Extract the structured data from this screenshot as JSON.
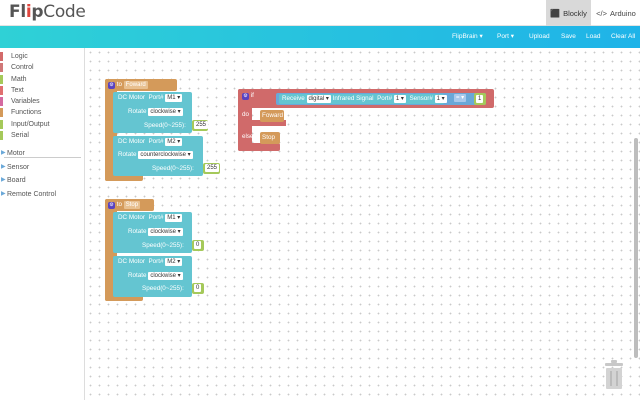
{
  "app": {
    "logo_left": "Fl",
    "logo_dot": "i",
    "logo_mid": "p",
    "logo_right": "Code"
  },
  "tabs": [
    {
      "label": "Blockly",
      "icon": "puzzle-icon"
    },
    {
      "label": "Arduino",
      "icon": "code-icon"
    }
  ],
  "toolbar": {
    "flipbrain": "FlipBrain",
    "port": "Port",
    "upload": "Upload",
    "save": "Save",
    "load": "Load",
    "clear": "Clear All"
  },
  "toolbox": {
    "categories": [
      {
        "label": "Logic",
        "color": "#d36a6a"
      },
      {
        "label": "Control",
        "color": "#d07878"
      },
      {
        "label": "Math",
        "color": "#a5c95a"
      },
      {
        "label": "Text",
        "color": "#e06f6f"
      },
      {
        "label": "Variables",
        "color": "#d46aa0"
      },
      {
        "label": "Functions",
        "color": "#d49a5a"
      },
      {
        "label": "Input/Output",
        "color": "#a5c95a"
      },
      {
        "label": "Serial",
        "color": "#a5c95a"
      }
    ],
    "groups": [
      "Motor",
      "Sensor",
      "Board",
      "Remote Control"
    ]
  },
  "blocks": {
    "to": "to",
    "foward_name": "Foward",
    "stop_name": "Stop",
    "dc_motor": "DC Motor",
    "port_label": "Port#",
    "rotate_label": "Rotate",
    "speed_label": "Speed(0~255):",
    "speed_label2": "Speed(0~255):",
    "m1": "M1",
    "m2": "M2",
    "clockwise": "clockwise",
    "counterclockwise": "counterclockwise",
    "speed255": "255",
    "speed0": "0",
    "if": "if",
    "receive": "Receive",
    "digital": "digital",
    "infrared": "Infrared Signal",
    "port": "Port#",
    "port1": "1",
    "sensor": "Sensor#",
    "sensor1": "1",
    "eq": "=",
    "one": "1",
    "do": "do",
    "else": "else",
    "call_foward": "Foward",
    "call_stop": "Stop"
  }
}
